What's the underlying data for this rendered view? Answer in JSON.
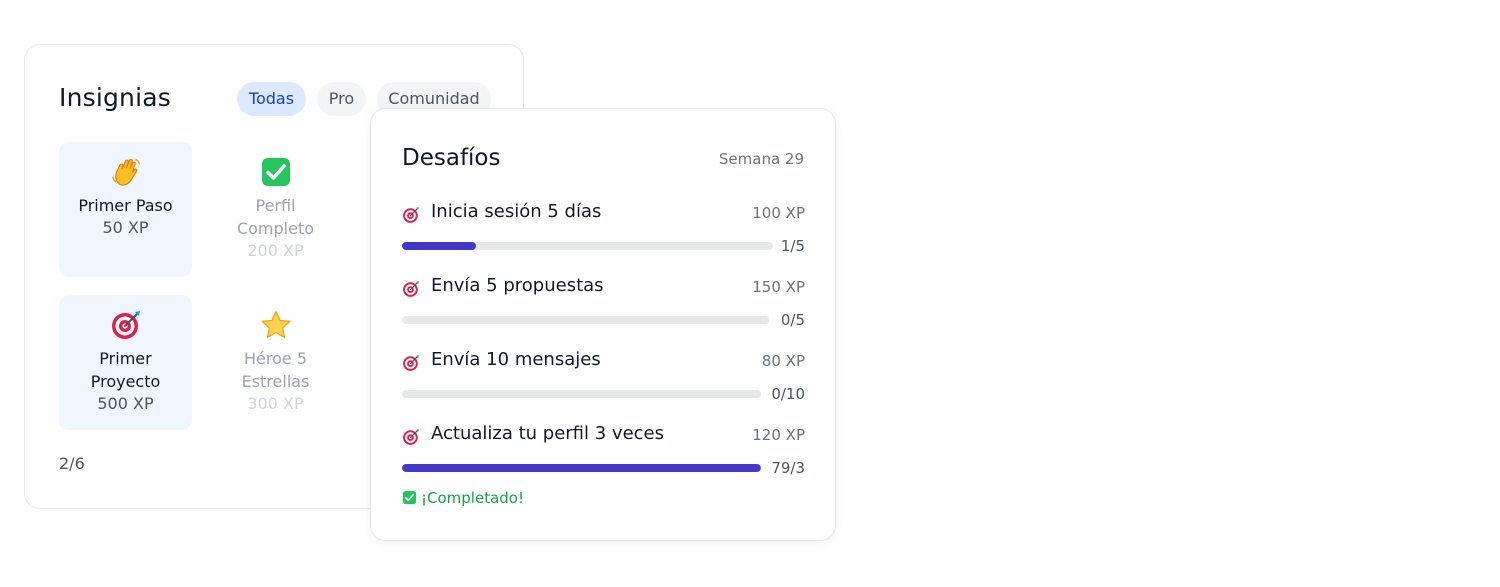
{
  "badges": {
    "title": "Insignias",
    "tabs": [
      "Todas",
      "Pro",
      "Comunidad"
    ],
    "active_tab": "Todas",
    "items": [
      {
        "icon": "waving-hand-icon",
        "name": "Primer Paso",
        "xp": "50 XP",
        "earned": true
      },
      {
        "icon": "check-mark-icon",
        "name": "Perfil Completo",
        "xp": "200 XP",
        "earned": false
      },
      {
        "icon": "target-icon",
        "name": "Primer Proyecto",
        "xp": "500 XP",
        "earned": true
      },
      {
        "icon": "star-icon",
        "name": "Héroe 5 Estrellas",
        "xp": "300 XP",
        "earned": false
      }
    ],
    "count": "2/6"
  },
  "challenges": {
    "title": "Desafíos",
    "week": "Semana 29",
    "items": [
      {
        "icon": "target-icon",
        "name": "Inicia sesión 5 días",
        "xp": "100 XP",
        "progress": "1/5",
        "fraction": 0.2
      },
      {
        "icon": "target-icon",
        "name": "Envía 5 propuestas",
        "xp": "150 XP",
        "progress": "0/5",
        "fraction": 0
      },
      {
        "icon": "target-icon",
        "name": "Envía 10 mensajes",
        "xp": "80 XP",
        "progress": "0/10",
        "fraction": 0
      },
      {
        "icon": "target-icon",
        "name": "Actualiza tu perfil 3 veces",
        "xp": "120 XP",
        "progress": "79/3",
        "fraction": 1
      }
    ],
    "completed_label": "¡Completado!"
  },
  "colors": {
    "accent": "#4338ca",
    "active_tab_bg": "#dbeafe",
    "earned_tile_bg": "#eff6ff",
    "success": "#16a34a"
  }
}
